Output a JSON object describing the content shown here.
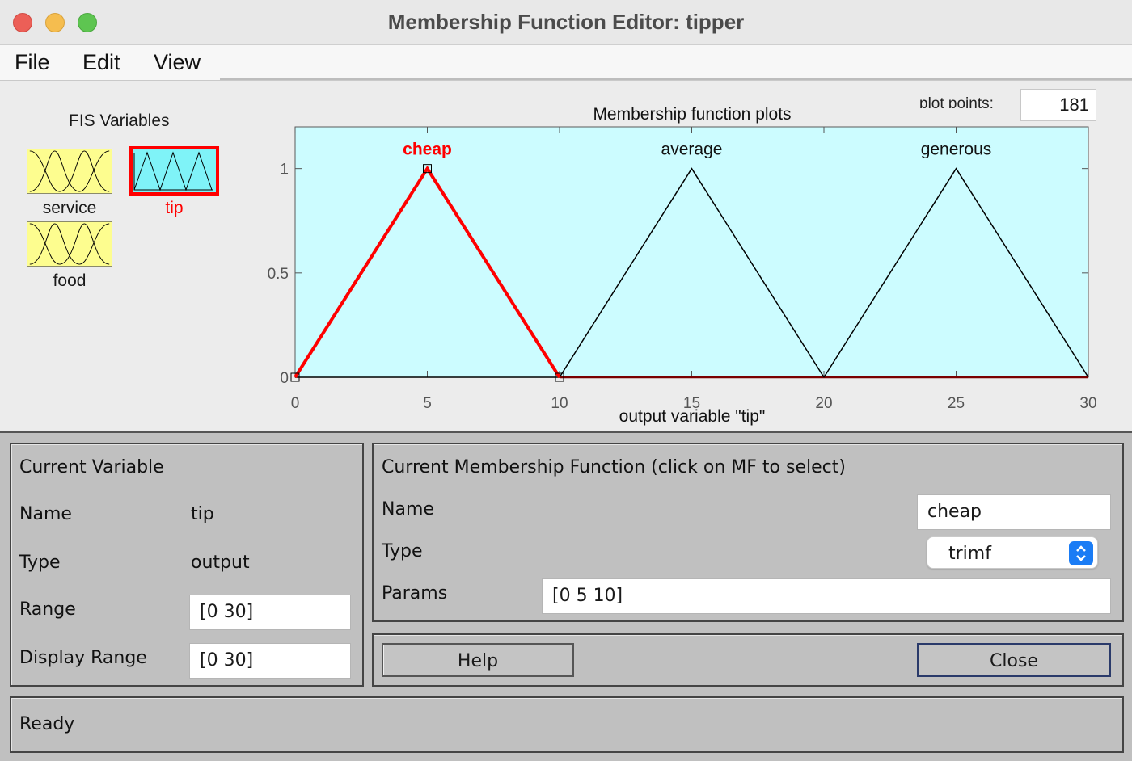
{
  "window": {
    "title": "Membership Function Editor: tipper"
  },
  "menu": [
    "File",
    "Edit",
    "View"
  ],
  "fis_variables": {
    "heading": "FIS Variables",
    "inputs": [
      {
        "label": "service"
      },
      {
        "label": "food"
      }
    ],
    "outputs": [
      {
        "label": "tip",
        "selected": true
      }
    ]
  },
  "plot": {
    "title": "Membership function plots",
    "plot_points_label": "plot points:",
    "plot_points_value": "181"
  },
  "chart_data": {
    "type": "line",
    "title": "Membership function plots",
    "xlabel": "output variable \"tip\"",
    "ylabel": "",
    "xlim": [
      0,
      30
    ],
    "ylim": [
      0,
      1.2
    ],
    "xticks": [
      "0",
      "5",
      "10",
      "15",
      "20",
      "25",
      "30"
    ],
    "yticks": [
      "0",
      "0.5",
      "1"
    ],
    "background": "#ccfcff",
    "series": [
      {
        "name": "cheap",
        "x": [
          0,
          5,
          10
        ],
        "y": [
          0,
          1,
          0
        ],
        "color": "#ff0000",
        "selected": true
      },
      {
        "name": "average",
        "x": [
          10,
          15,
          20
        ],
        "y": [
          0,
          1,
          0
        ],
        "color": "#000000"
      },
      {
        "name": "generous",
        "x": [
          20,
          25,
          30
        ],
        "y": [
          0,
          1,
          0
        ],
        "color": "#000000"
      }
    ]
  },
  "current_variable": {
    "heading": "Current Variable",
    "name_label": "Name",
    "name_value": "tip",
    "type_label": "Type",
    "type_value": "output",
    "range_label": "Range",
    "range_value": "[0 30]",
    "display_range_label": "Display Range",
    "display_range_value": "[0 30]"
  },
  "current_mf": {
    "heading": "Current Membership Function (click on MF to select)",
    "name_label": "Name",
    "name_value": "cheap",
    "type_label": "Type",
    "type_value": "trimf",
    "params_label": "Params",
    "params_value": "[0 5 10]"
  },
  "buttons": {
    "help": "Help",
    "close": "Close"
  },
  "status": "Ready"
}
